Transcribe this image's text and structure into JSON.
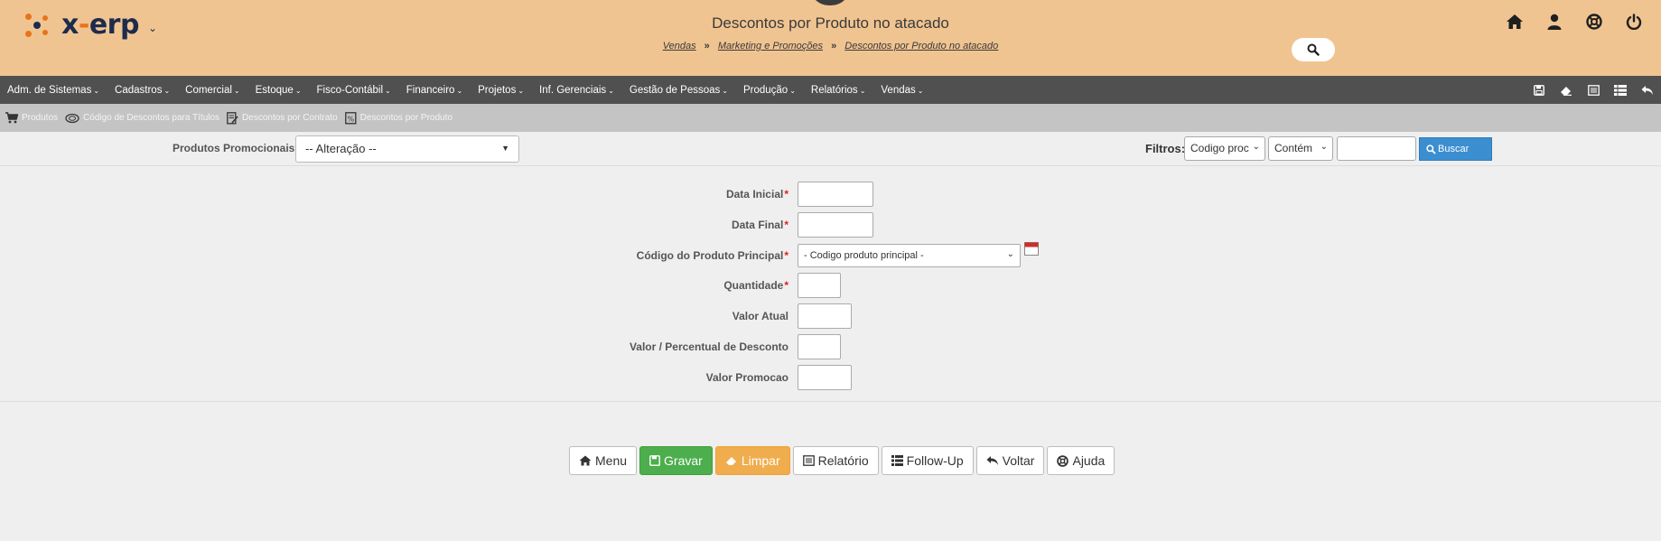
{
  "header": {
    "logo_text_a": "x",
    "logo_text_dash": "-",
    "logo_text_b": "erp",
    "logo_caret": "⌄",
    "title": "Descontos por Produto no atacado",
    "breadcrumb": [
      "Vendas",
      "Marketing e Promoções",
      "Descontos por Produto no atacado"
    ],
    "breadcrumb_sep": "»",
    "icons": [
      "home-icon",
      "user-icon",
      "help-lifebuoy-icon",
      "power-icon"
    ]
  },
  "menu": {
    "items": [
      "Adm. de Sistemas",
      "Cadastros",
      "Comercial",
      "Estoque",
      "Fisco-Contábil",
      "Financeiro",
      "Projetos",
      "Inf. Gerenciais",
      "Gestão de Pessoas",
      "Produção",
      "Relatórios",
      "Vendas"
    ],
    "caret": "⌄",
    "tools": [
      "save-icon",
      "eraser-icon",
      "report-icon",
      "list-icon",
      "undo-icon"
    ]
  },
  "submenu": {
    "items": [
      "Produtos",
      "Código de Descontos para Títulos",
      "Descontos por Contrato",
      "Descontos por Produto"
    ]
  },
  "filterbar": {
    "produtos_label": "Produtos Promocionais",
    "produtos_value": "-- Alteração --",
    "filtros_label": "Filtros:",
    "filter_field": "Codigo proc",
    "filter_op": "Contém",
    "filter_value": "",
    "buscar_label": "Buscar"
  },
  "form": {
    "data_inicial_label": "Data Inicial",
    "data_final_label": "Data Final",
    "codigo_label": "Código do Produto Principal",
    "codigo_value": "- Codigo produto principal -",
    "quantidade_label": "Quantidade",
    "valor_atual_label": "Valor Atual",
    "valor_desconto_label": "Valor / Percentual de Desconto",
    "valor_promocao_label": "Valor Promocao",
    "required_mark": "*"
  },
  "buttons": {
    "menu": "Menu",
    "gravar": "Gravar",
    "limpar": "Limpar",
    "relatorio": "Relatório",
    "followup": "Follow-Up",
    "voltar": "Voltar",
    "ajuda": "Ajuda"
  },
  "colors": {
    "header_bg": "#f0c491",
    "menubar_bg": "#505050",
    "submenu_bg": "#c4c4c4",
    "accent_blue": "#3b8ed0",
    "green": "#4cae4c",
    "orange": "#f0ad4e",
    "required": "#e02020"
  }
}
